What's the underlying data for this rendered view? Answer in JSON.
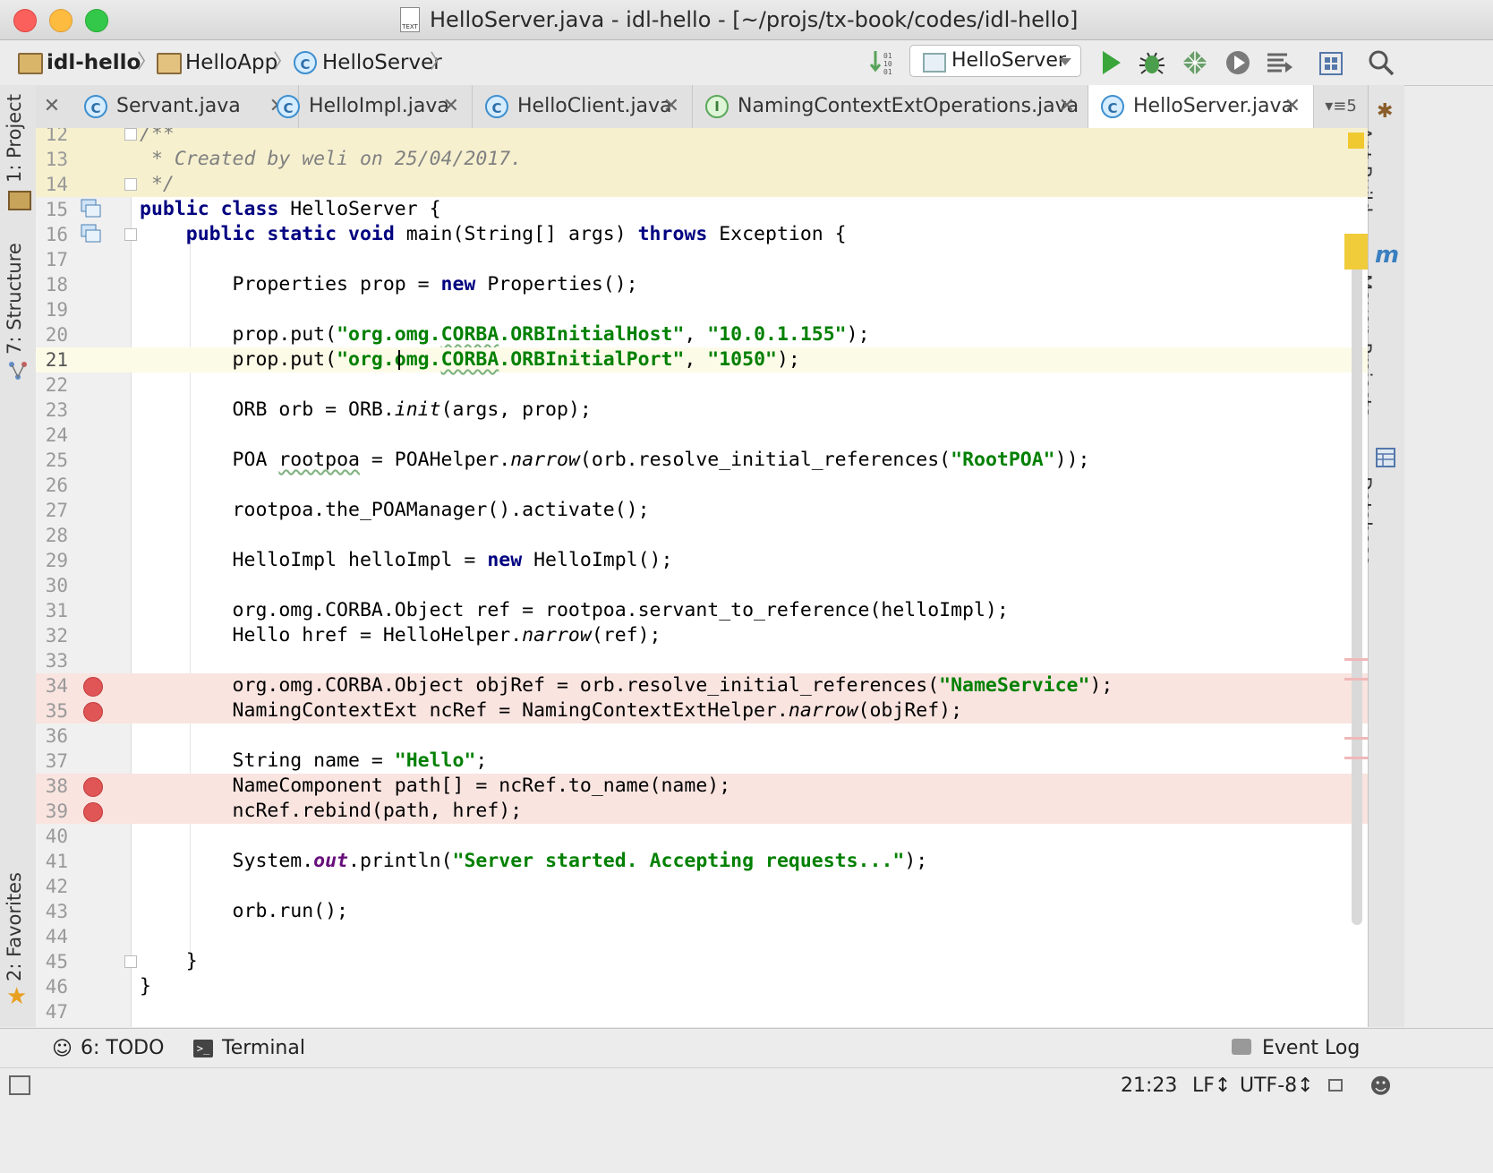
{
  "window": {
    "title": "HelloServer.java - idl-hello - [~/projs/tx-book/codes/idl-hello]",
    "title_icon_text": "TEXT"
  },
  "breadcrumbs": [
    {
      "label": "idl-hello",
      "icon": "module-folder-icon"
    },
    {
      "label": "HelloApp",
      "icon": "package-folder-icon"
    },
    {
      "label": "HelloServer",
      "icon": "class-icon"
    }
  ],
  "toolbar": {
    "run_config": "HelloServer",
    "buttons": [
      "sort-icon",
      "run-icon",
      "debug-icon",
      "coverage-icon",
      "profile-icon",
      "build-icon",
      "project-structure-icon",
      "search-icon"
    ]
  },
  "tabs": [
    {
      "label": "Servant.java",
      "icon": "C"
    },
    {
      "label": "HelloImpl.java",
      "icon": "C"
    },
    {
      "label": "HelloClient.java",
      "icon": "C"
    },
    {
      "label": "NamingContextExtOperations.java",
      "icon": "I"
    },
    {
      "label": "HelloServer.java",
      "icon": "C",
      "active": true
    }
  ],
  "tabs_overflow_count": "5",
  "left_tool_tabs": [
    "1: Project",
    "7: Structure",
    "2: Favorites"
  ],
  "right_tool_tabs": [
    "Ant Build",
    "Maven Projects",
    "Database"
  ],
  "colors": {
    "keyword": "#000080",
    "string": "#008000",
    "comment": "#808080",
    "breakpoint": "#e05555",
    "breakpoint_line": "#f9e4e0"
  },
  "editor": {
    "lines": [
      {
        "n": "12",
        "text": "/**"
      },
      {
        "n": "13",
        "text": " * Created by weli on 25/04/2017."
      },
      {
        "n": "14",
        "text": " */"
      },
      {
        "n": "15",
        "text": "public class HelloServer {"
      },
      {
        "n": "16",
        "text": "    public static void main(String[] args) throws Exception {"
      },
      {
        "n": "17",
        "text": ""
      },
      {
        "n": "18",
        "text": "        Properties prop = new Properties();"
      },
      {
        "n": "19",
        "text": ""
      },
      {
        "n": "20",
        "text": "        prop.put(\"org.omg.CORBA.ORBInitialHost\", \"10.0.1.155\");"
      },
      {
        "n": "21",
        "text": "        prop.put(\"org.omg.CORBA.ORBInitialPort\", \"1050\");"
      },
      {
        "n": "22",
        "text": ""
      },
      {
        "n": "23",
        "text": "        ORB orb = ORB.init(args, prop);"
      },
      {
        "n": "24",
        "text": ""
      },
      {
        "n": "25",
        "text": "        POA rootpoa = POAHelper.narrow(orb.resolve_initial_references(\"RootPOA\"));"
      },
      {
        "n": "26",
        "text": ""
      },
      {
        "n": "27",
        "text": "        rootpoa.the_POAManager().activate();"
      },
      {
        "n": "28",
        "text": ""
      },
      {
        "n": "29",
        "text": "        HelloImpl helloImpl = new HelloImpl();"
      },
      {
        "n": "30",
        "text": ""
      },
      {
        "n": "31",
        "text": "        org.omg.CORBA.Object ref = rootpoa.servant_to_reference(helloImpl);"
      },
      {
        "n": "32",
        "text": "        Hello href = HelloHelper.narrow(ref);"
      },
      {
        "n": "33",
        "text": ""
      },
      {
        "n": "34",
        "text": "        org.omg.CORBA.Object objRef = orb.resolve_initial_references(\"NameService\");"
      },
      {
        "n": "35",
        "text": "        NamingContextExt ncRef = NamingContextExtHelper.narrow(objRef);"
      },
      {
        "n": "36",
        "text": ""
      },
      {
        "n": "37",
        "text": "        String name = \"Hello\";"
      },
      {
        "n": "38",
        "text": "        NameComponent path[] = ncRef.to_name(name);"
      },
      {
        "n": "39",
        "text": "        ncRef.rebind(path, href);"
      },
      {
        "n": "40",
        "text": ""
      },
      {
        "n": "41",
        "text": "        System.out.println(\"Server started. Accepting requests...\");"
      },
      {
        "n": "42",
        "text": ""
      },
      {
        "n": "43",
        "text": "        orb.run();"
      },
      {
        "n": "44",
        "text": ""
      },
      {
        "n": "45",
        "text": "    }"
      },
      {
        "n": "46",
        "text": "}"
      },
      {
        "n": "47",
        "text": ""
      }
    ]
  },
  "bottom_tools": {
    "todo": "6: TODO",
    "terminal": "Terminal",
    "event_log": "Event Log"
  },
  "status": {
    "position": "21:23",
    "line_sep": "LF↕",
    "encoding": "UTF-8↕"
  }
}
